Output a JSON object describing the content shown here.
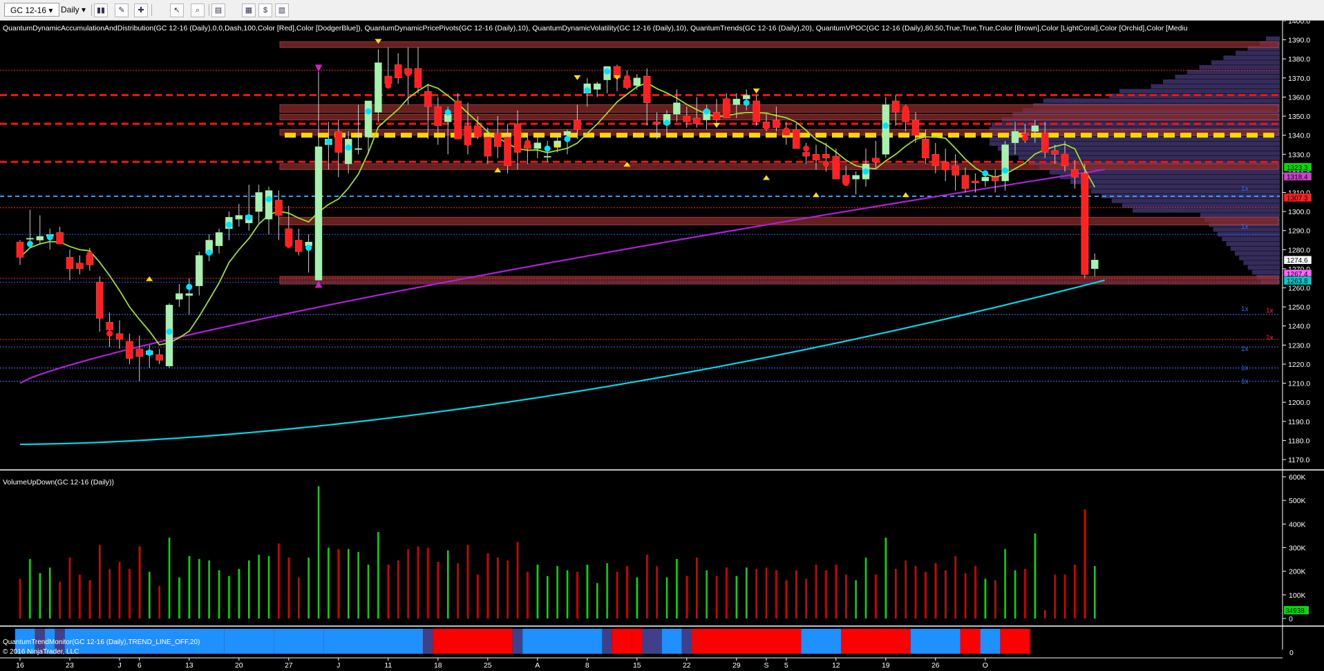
{
  "toolbar": {
    "instrument": "GC 12-16",
    "timeframe": "Daily",
    "buttons": [
      "bar-type-icon",
      "pencil-icon",
      "drawing-tools-icon",
      "cursor-icon",
      "zoom-icon",
      "properties-icon",
      "templates-icon",
      "strategy-icon",
      "data-box-icon"
    ]
  },
  "indicator_header": "QuantumDynamicAccumulationAndDistribution(GC 12-16 (Daily),0,0,Dash,100,Color [Red],Color [DodgerBlue]), QuantumDynamicPricePivots(GC 12-16 (Daily),10), QuantumDynamicVolatility(GC 12-16 (Daily),10), QuantumTrends(GC 12-16 (Daily),20), QuantumVPOC(GC 12-16 (Daily),80,50,True,True,True,Color [Brown],Color [LightCoral],Color [Orchid],Color [Mediu",
  "volume_title": "VolumeUpDown(GC 12-16 (Daily))",
  "trend_title": "QuantumTrendMonitor(GC 12-16 (Daily),TREND_LINE_OFF,20)",
  "copyright": "© 2016 NinjaTrader, LLC",
  "colors": {
    "up": "#a8f0b0",
    "down": "#ff2020",
    "vol_up": "#00e000",
    "vol_down": "#e00000",
    "trend_blue": "#1e90ff",
    "trend_red": "#ff0000",
    "trend_navy": "#40408a"
  },
  "chart_data": [
    {
      "type": "candlestick",
      "ylim": [
        1165,
        1400
      ],
      "y_ticks": [
        1170,
        1180,
        1190,
        1200,
        1210,
        1220,
        1230,
        1240,
        1250,
        1260,
        1270,
        1280,
        1290,
        1300,
        1310,
        1320,
        1330,
        1340,
        1350,
        1360,
        1370,
        1380,
        1390,
        1400
      ],
      "x_tick_labels": [
        {
          "i": 0,
          "label": "16"
        },
        {
          "i": 5,
          "label": "23"
        },
        {
          "i": 10,
          "label": "J"
        },
        {
          "i": 12,
          "label": "6"
        },
        {
          "i": 17,
          "label": "13"
        },
        {
          "i": 22,
          "label": "20"
        },
        {
          "i": 27,
          "label": "27"
        },
        {
          "i": 32,
          "label": "J"
        },
        {
          "i": 37,
          "label": "11"
        },
        {
          "i": 42,
          "label": "18"
        },
        {
          "i": 47,
          "label": "25"
        },
        {
          "i": 52,
          "label": "A"
        },
        {
          "i": 57,
          "label": "8"
        },
        {
          "i": 62,
          "label": "15"
        },
        {
          "i": 67,
          "label": "22"
        },
        {
          "i": 72,
          "label": "29"
        },
        {
          "i": 75,
          "label": "S"
        },
        {
          "i": 77,
          "label": "5"
        },
        {
          "i": 82,
          "label": "12"
        },
        {
          "i": 87,
          "label": "19"
        },
        {
          "i": 92,
          "label": "26"
        },
        {
          "i": 97,
          "label": "O"
        }
      ],
      "candles": [
        [
          1284,
          1285,
          1272,
          1276
        ],
        [
          1286,
          1301,
          1282,
          1286
        ],
        [
          1285,
          1298,
          1283,
          1287
        ],
        [
          1287,
          1291,
          1280,
          1288
        ],
        [
          1289,
          1292,
          1285,
          1283
        ],
        [
          1276,
          1280,
          1264,
          1270
        ],
        [
          1273,
          1277,
          1267,
          1270
        ],
        [
          1277,
          1281,
          1269,
          1272
        ],
        [
          1263,
          1266,
          1237,
          1244
        ],
        [
          1242,
          1247,
          1229,
          1238
        ],
        [
          1236,
          1243,
          1228,
          1233
        ],
        [
          1232,
          1236,
          1220,
          1223
        ],
        [
          1228,
          1235,
          1211,
          1224
        ],
        [
          1225,
          1230,
          1218,
          1227
        ],
        [
          1225,
          1228,
          1220,
          1222
        ],
        [
          1219,
          1252,
          1218,
          1251
        ],
        [
          1254,
          1262,
          1250,
          1257
        ],
        [
          1256,
          1265,
          1246,
          1257
        ],
        [
          1261,
          1279,
          1256,
          1277
        ],
        [
          1278,
          1288,
          1274,
          1285
        ],
        [
          1282,
          1291,
          1278,
          1289
        ],
        [
          1291,
          1300,
          1285,
          1297
        ],
        [
          1296,
          1304,
          1292,
          1298
        ],
        [
          1294,
          1314,
          1290,
          1298
        ],
        [
          1300,
          1314,
          1294,
          1310
        ],
        [
          1296,
          1313,
          1288,
          1311
        ],
        [
          1306,
          1311,
          1285,
          1298
        ],
        [
          1291,
          1303,
          1281,
          1282
        ],
        [
          1285,
          1291,
          1277,
          1279
        ],
        [
          1282,
          1288,
          1268,
          1284
        ],
        [
          1264,
          1375,
          1264,
          1334
        ],
        [
          1335,
          1347,
          1322,
          1338
        ],
        [
          1342,
          1348,
          1318,
          1331
        ],
        [
          1325,
          1342,
          1320,
          1338
        ],
        [
          1333,
          1356,
          1330,
          1333
        ],
        [
          1339,
          1353,
          1330,
          1358
        ],
        [
          1352,
          1385,
          1347,
          1378
        ],
        [
          1371,
          1386,
          1365,
          1367
        ],
        [
          1377,
          1383,
          1367,
          1370
        ],
        [
          1375,
          1386,
          1356,
          1372
        ],
        [
          1375,
          1386,
          1362,
          1365
        ],
        [
          1363,
          1367,
          1338,
          1355
        ],
        [
          1355,
          1360,
          1335,
          1345
        ],
        [
          1347,
          1355,
          1330,
          1351
        ],
        [
          1358,
          1362,
          1340,
          1338
        ],
        [
          1345,
          1357,
          1330,
          1335
        ],
        [
          1345,
          1350,
          1338,
          1339
        ],
        [
          1339,
          1344,
          1325,
          1329
        ],
        [
          1341,
          1350,
          1328,
          1334
        ],
        [
          1339,
          1346,
          1320,
          1324
        ],
        [
          1346,
          1353,
          1322,
          1331
        ],
        [
          1335,
          1341,
          1325,
          1333
        ],
        [
          1333,
          1341,
          1328,
          1336
        ],
        [
          1329,
          1337,
          1326,
          1329
        ],
        [
          1334,
          1341,
          1331,
          1337
        ],
        [
          1340,
          1343,
          1330,
          1342
        ],
        [
          1348,
          1356,
          1338,
          1343
        ],
        [
          1362,
          1370,
          1355,
          1367
        ],
        [
          1364,
          1368,
          1360,
          1367
        ],
        [
          1369,
          1376,
          1362,
          1376
        ],
        [
          1376,
          1377,
          1363,
          1370
        ],
        [
          1369,
          1374,
          1364,
          1365
        ],
        [
          1366,
          1372,
          1364,
          1370
        ],
        [
          1371,
          1375,
          1345,
          1357
        ],
        [
          1347,
          1352,
          1338,
          1346
        ],
        [
          1346,
          1353,
          1341,
          1351
        ],
        [
          1351,
          1364,
          1347,
          1357
        ],
        [
          1350,
          1355,
          1344,
          1347
        ],
        [
          1349,
          1360,
          1344,
          1346
        ],
        [
          1348,
          1356,
          1343,
          1353
        ],
        [
          1352,
          1359,
          1344,
          1348
        ],
        [
          1359,
          1362,
          1349,
          1349
        ],
        [
          1356,
          1362,
          1349,
          1359
        ],
        [
          1359,
          1364,
          1353,
          1361
        ],
        [
          1358,
          1361,
          1345,
          1347
        ],
        [
          1347,
          1351,
          1342,
          1344
        ],
        [
          1348,
          1355,
          1342,
          1344
        ],
        [
          1343,
          1347,
          1335,
          1340
        ],
        [
          1343,
          1346,
          1335,
          1333
        ],
        [
          1331,
          1336,
          1325,
          1329
        ],
        [
          1330,
          1335,
          1322,
          1327
        ],
        [
          1330,
          1336,
          1321,
          1328
        ],
        [
          1329,
          1333,
          1322,
          1317
        ],
        [
          1319,
          1324,
          1314,
          1315
        ],
        [
          1317,
          1321,
          1309,
          1319
        ],
        [
          1317,
          1333,
          1313,
          1325
        ],
        [
          1328,
          1337,
          1323,
          1326
        ],
        [
          1330,
          1360,
          1328,
          1356
        ],
        [
          1358,
          1361,
          1345,
          1352
        ],
        [
          1353,
          1356,
          1342,
          1347
        ],
        [
          1348,
          1352,
          1336,
          1340
        ],
        [
          1338,
          1343,
          1325,
          1328
        ],
        [
          1330,
          1336,
          1320,
          1324
        ],
        [
          1326,
          1333,
          1316,
          1322
        ],
        [
          1324,
          1330,
          1311,
          1319
        ],
        [
          1319,
          1323,
          1310,
          1312
        ],
        [
          1316,
          1320,
          1310,
          1315
        ],
        [
          1316,
          1320,
          1313,
          1318
        ],
        [
          1318,
          1322,
          1310,
          1316
        ],
        [
          1316,
          1337,
          1311,
          1335
        ],
        [
          1336,
          1347,
          1330,
          1342
        ],
        [
          1341,
          1346,
          1336,
          1340
        ],
        [
          1342,
          1348,
          1336,
          1345
        ],
        [
          1341,
          1347,
          1328,
          1331
        ],
        [
          1332,
          1335,
          1325,
          1330
        ],
        [
          1330,
          1337,
          1321,
          1324
        ],
        [
          1322,
          1327,
          1312,
          1318
        ],
        [
          1320,
          1325,
          1265,
          1267
        ],
        [
          1270,
          1278,
          1266,
          1274.6
        ]
      ],
      "price_badges": [
        {
          "value": "1323.3",
          "color": "#00e000"
        },
        {
          "value": "1318.4",
          "color": "#cc44cc"
        },
        {
          "value": "1307.3",
          "color": "#ff2020"
        },
        {
          "value": "1274.6",
          "color": "#ffffff"
        },
        {
          "value": "1267.4",
          "color": "#ff66ff"
        },
        {
          "value": "1263.8",
          "color": "#00cccc"
        }
      ],
      "resistance_levels": [
        1361,
        1346,
        1326
      ],
      "pivot_levels": [
        1340
      ],
      "blue_levels": [
        1308
      ],
      "vpoc_marks": [
        "1x",
        "1x",
        "1x",
        "1x",
        "1x",
        "1x",
        "1x",
        "1x"
      ]
    },
    {
      "type": "bar",
      "title": "VolumeUpDown(GC 12-16 (Daily))",
      "ylim": [
        0,
        600000
      ],
      "y_ticks": [
        "0",
        "100K",
        "200K",
        "300K",
        "400K",
        "500K",
        "600K"
      ],
      "last_value": "34938"
    },
    {
      "type": "heatmap",
      "title": "QuantumTrendMonitor(GC 12-16 (Daily),TREND_LINE_OFF,20)",
      "y_ticks": [
        "0"
      ],
      "segments": [
        [
          "blue",
          2
        ],
        [
          "navy",
          1
        ],
        [
          "blue",
          1
        ],
        [
          "navy",
          1
        ],
        [
          "blue",
          13
        ],
        [
          "blue",
          3
        ],
        [
          "blue",
          5
        ],
        [
          "blue",
          5
        ],
        [
          "blue",
          10
        ],
        [
          "navy",
          1
        ],
        [
          "red",
          1
        ],
        [
          "red",
          6
        ],
        [
          "red",
          1
        ],
        [
          "navy",
          1
        ],
        [
          "blue",
          8
        ],
        [
          "navy",
          1
        ],
        [
          "red",
          2
        ],
        [
          "red",
          1
        ],
        [
          "navy",
          2
        ],
        [
          "blue",
          2
        ],
        [
          "navy",
          1
        ],
        [
          "red",
          11
        ],
        [
          "blue",
          4
        ],
        [
          "red",
          1
        ],
        [
          "red",
          6
        ],
        [
          "blue",
          5
        ],
        [
          "red",
          2
        ],
        [
          "blue",
          2
        ],
        [
          "red",
          3
        ]
      ]
    }
  ]
}
